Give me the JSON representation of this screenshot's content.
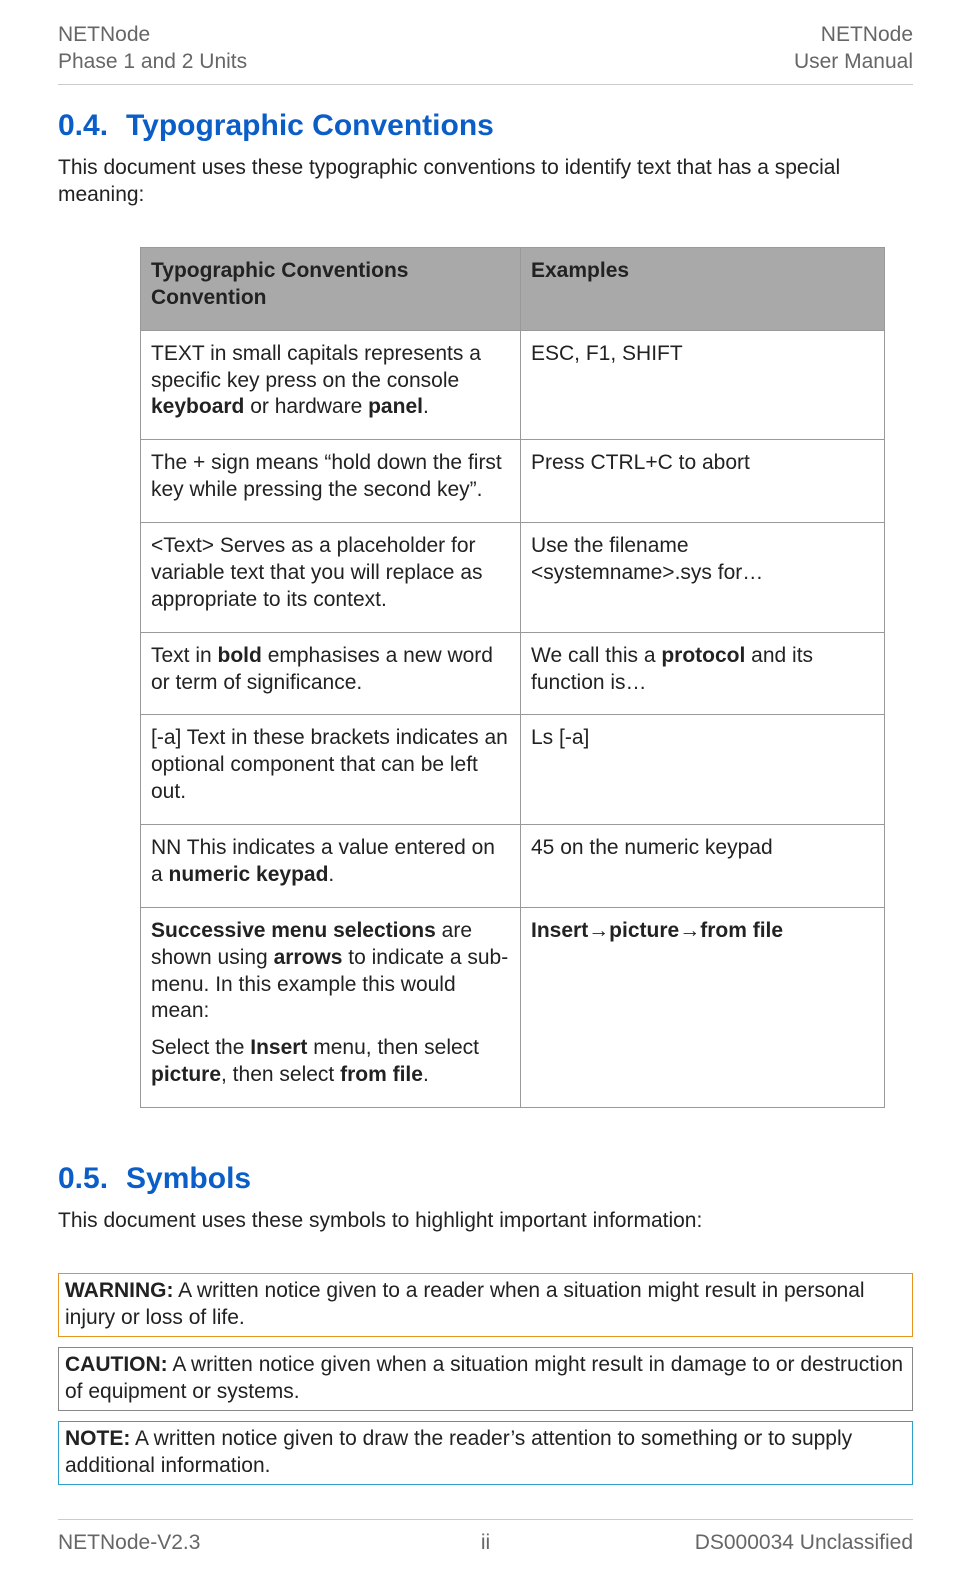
{
  "header": {
    "left_line1": "NETNode",
    "left_line2": "Phase 1 and 2 Units",
    "right_line1": "NETNode",
    "right_line2": "User Manual"
  },
  "section04": {
    "num": "0.4.",
    "title": "Typographic Conventions",
    "intro": "This document uses these typographic conventions to identify text that has a special meaning:",
    "table": {
      "header_col1_line1": "Typographic Conventions",
      "header_col1_line2": "Convention",
      "header_col2": "Examples",
      "rows": [
        {
          "conv_pre": "TEXT in small capitals represents a specific key press on the console ",
          "conv_b1": "keyboard",
          "conv_mid": " or hardware ",
          "conv_b2": "panel",
          "conv_post": ".",
          "example": "ESC,  F1, SHIFT"
        },
        {
          "conv": "The + sign means “hold down the first key while pressing the second key”.",
          "example": "Press CTRL+C to abort"
        },
        {
          "conv": "<Text> Serves as a placeholder for variable text that you will replace as appropriate to its context.",
          "example": "Use the filename <systemname>.sys for…"
        },
        {
          "conv_pre": "Text in ",
          "conv_b1": "bold",
          "conv_post": " emphasises a new word or term of significance.",
          "example_pre": "We call this a ",
          "example_b": "protocol",
          "example_post": " and its function is…"
        },
        {
          "conv": "[-a] Text in these brackets indicates an optional component that can be left out.",
          "example": "Ls [-a]"
        },
        {
          "conv_pre": "NN This indicates a value entered on a ",
          "conv_b1": "numeric keypad",
          "conv_post": ".",
          "example": "45 on the numeric keypad"
        },
        {
          "conv_b1": "Successive menu selections",
          "conv_mid1": " are shown using ",
          "conv_b2": "arrows",
          "conv_mid2": " to indicate a sub-menu. In this example this would mean:",
          "conv_p2_pre": "Select the ",
          "conv_p2_b1": "Insert",
          "conv_p2_mid1": " menu, then select ",
          "conv_p2_b2": "picture",
          "conv_p2_mid2": ", then select ",
          "conv_p2_b3": "from file",
          "conv_p2_post": ".",
          "example_b": "Insert→picture→from file"
        }
      ]
    }
  },
  "section05": {
    "num": "0.5.",
    "title": "Symbols",
    "intro": "This document uses these symbols to highlight important information:",
    "warning_label": "WARNING:",
    "warning_text": " A written notice given to a reader when a situation might result in personal injury or loss of life.",
    "caution_label": "CAUTION:",
    "caution_text": " A written notice given when a situation might result in damage to or destruction of equipment or systems.",
    "note_label": "NOTE:",
    "note_text": " A written notice given to draw the reader’s attention to something or to supply additional information."
  },
  "footer": {
    "left": "NETNode-V2.3",
    "center": "ii",
    "right": "DS000034 Unclassified"
  }
}
